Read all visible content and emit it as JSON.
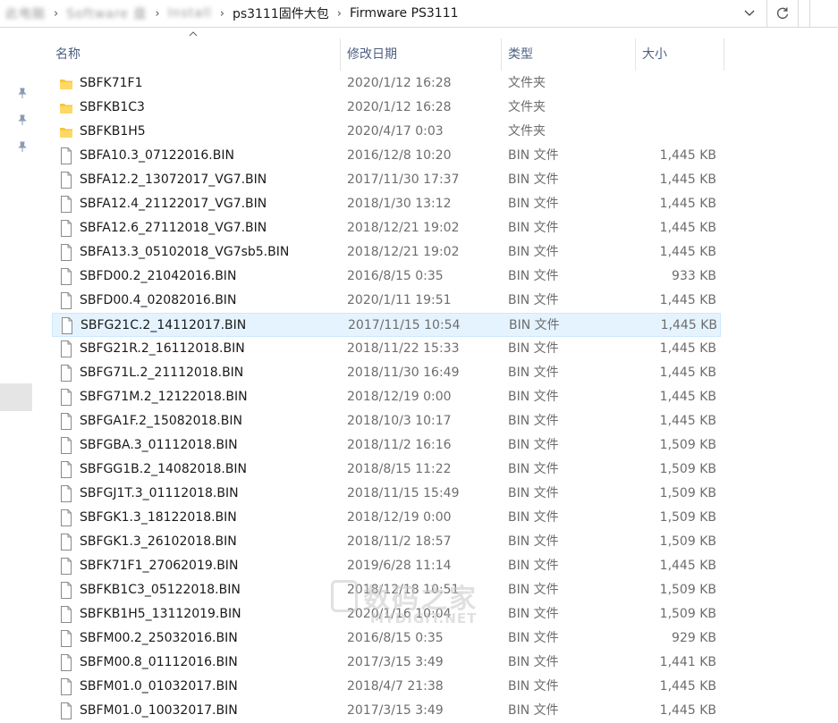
{
  "address_bar": {
    "crumbs": [
      {
        "text": "此电脑",
        "blurred": true
      },
      {
        "text": "Software 盘",
        "blurred": true
      },
      {
        "text": "Install",
        "blurred": true
      },
      {
        "text": "ps3111固件大包",
        "blurred": false
      },
      {
        "text": "Firmware PS3111",
        "blurred": false
      }
    ]
  },
  "columns": {
    "name": "名称",
    "date": "修改日期",
    "type": "类型",
    "size": "大小"
  },
  "rows": [
    {
      "name": "SBFK71F1",
      "date": "2020/1/12 16:28",
      "type": "文件夹",
      "size": "",
      "icon": "folder-icon"
    },
    {
      "name": "SBFKB1C3",
      "date": "2020/1/12 16:28",
      "type": "文件夹",
      "size": "",
      "icon": "folder-icon"
    },
    {
      "name": "SBFKB1H5",
      "date": "2020/4/17 0:03",
      "type": "文件夹",
      "size": "",
      "icon": "folder-icon"
    },
    {
      "name": "SBFA10.3_07122016.BIN",
      "date": "2016/12/8 10:20",
      "type": "BIN 文件",
      "size": "1,445 KB",
      "icon": "file-icon"
    },
    {
      "name": "SBFA12.2_13072017_VG7.BIN",
      "date": "2017/11/30 17:37",
      "type": "BIN 文件",
      "size": "1,445 KB",
      "icon": "file-icon"
    },
    {
      "name": "SBFA12.4_21122017_VG7.BIN",
      "date": "2018/1/30 13:12",
      "type": "BIN 文件",
      "size": "1,445 KB",
      "icon": "file-icon"
    },
    {
      "name": "SBFA12.6_27112018_VG7.BIN",
      "date": "2018/12/21 19:02",
      "type": "BIN 文件",
      "size": "1,445 KB",
      "icon": "file-icon"
    },
    {
      "name": "SBFA13.3_05102018_VG7sb5.BIN",
      "date": "2018/12/21 19:02",
      "type": "BIN 文件",
      "size": "1,445 KB",
      "icon": "file-icon"
    },
    {
      "name": "SBFD00.2_21042016.BIN",
      "date": "2016/8/15 0:35",
      "type": "BIN 文件",
      "size": "933 KB",
      "icon": "file-icon"
    },
    {
      "name": "SBFD00.4_02082016.BIN",
      "date": "2020/1/11 19:51",
      "type": "BIN 文件",
      "size": "1,445 KB",
      "icon": "file-icon"
    },
    {
      "name": "SBFG21C.2_14112017.BIN",
      "date": "2017/11/15 10:54",
      "type": "BIN 文件",
      "size": "1,445 KB",
      "icon": "file-icon",
      "selected": true
    },
    {
      "name": "SBFG21R.2_16112018.BIN",
      "date": "2018/11/22 15:33",
      "type": "BIN 文件",
      "size": "1,445 KB",
      "icon": "file-icon"
    },
    {
      "name": "SBFG71L.2_21112018.BIN",
      "date": "2018/11/30 16:49",
      "type": "BIN 文件",
      "size": "1,445 KB",
      "icon": "file-icon"
    },
    {
      "name": "SBFG71M.2_12122018.BIN",
      "date": "2018/12/19 0:00",
      "type": "BIN 文件",
      "size": "1,445 KB",
      "icon": "file-icon"
    },
    {
      "name": "SBFGA1F.2_15082018.BIN",
      "date": "2018/10/3 10:17",
      "type": "BIN 文件",
      "size": "1,445 KB",
      "icon": "file-icon"
    },
    {
      "name": "SBFGBA.3_01112018.BIN",
      "date": "2018/11/2 16:16",
      "type": "BIN 文件",
      "size": "1,509 KB",
      "icon": "file-icon"
    },
    {
      "name": "SBFGG1B.2_14082018.BIN",
      "date": "2018/8/15 11:22",
      "type": "BIN 文件",
      "size": "1,509 KB",
      "icon": "file-icon"
    },
    {
      "name": "SBFGJ1T.3_01112018.BIN",
      "date": "2018/11/15 15:49",
      "type": "BIN 文件",
      "size": "1,509 KB",
      "icon": "file-icon"
    },
    {
      "name": "SBFGK1.3_18122018.BIN",
      "date": "2018/12/19 0:00",
      "type": "BIN 文件",
      "size": "1,509 KB",
      "icon": "file-icon"
    },
    {
      "name": "SBFGK1.3_26102018.BIN",
      "date": "2018/11/2 18:57",
      "type": "BIN 文件",
      "size": "1,509 KB",
      "icon": "file-icon"
    },
    {
      "name": "SBFK71F1_27062019.BIN",
      "date": "2019/6/28 11:14",
      "type": "BIN 文件",
      "size": "1,445 KB",
      "icon": "file-icon"
    },
    {
      "name": "SBFKB1C3_05122018.BIN",
      "date": "2018/12/18 10:51",
      "type": "BIN 文件",
      "size": "1,509 KB",
      "icon": "file-icon"
    },
    {
      "name": "SBFKB1H5_13112019.BIN",
      "date": "2020/1/16 10:04",
      "type": "BIN 文件",
      "size": "1,509 KB",
      "icon": "file-icon"
    },
    {
      "name": "SBFM00.2_25032016.BIN",
      "date": "2016/8/15 0:35",
      "type": "BIN 文件",
      "size": "929 KB",
      "icon": "file-icon"
    },
    {
      "name": "SBFM00.8_01112016.BIN",
      "date": "2017/3/15 3:49",
      "type": "BIN 文件",
      "size": "1,441 KB",
      "icon": "file-icon"
    },
    {
      "name": "SBFM01.0_01032017.BIN",
      "date": "2018/4/7 21:38",
      "type": "BIN 文件",
      "size": "1,445 KB",
      "icon": "file-icon"
    },
    {
      "name": "SBFM01.0_10032017.BIN",
      "date": "2017/3/15 3:49",
      "type": "BIN 文件",
      "size": "1,445 KB",
      "icon": "file-icon"
    }
  ],
  "watermark": {
    "cn": "数码之家",
    "en": "MYDIGIT.NET"
  },
  "colors": {
    "header_text": "#4d6082",
    "meta_text": "#6d6d6d",
    "selected_bg": "#e5f3ff",
    "selected_border": "#cce8ff",
    "folder_yellow": "#f5c643"
  }
}
